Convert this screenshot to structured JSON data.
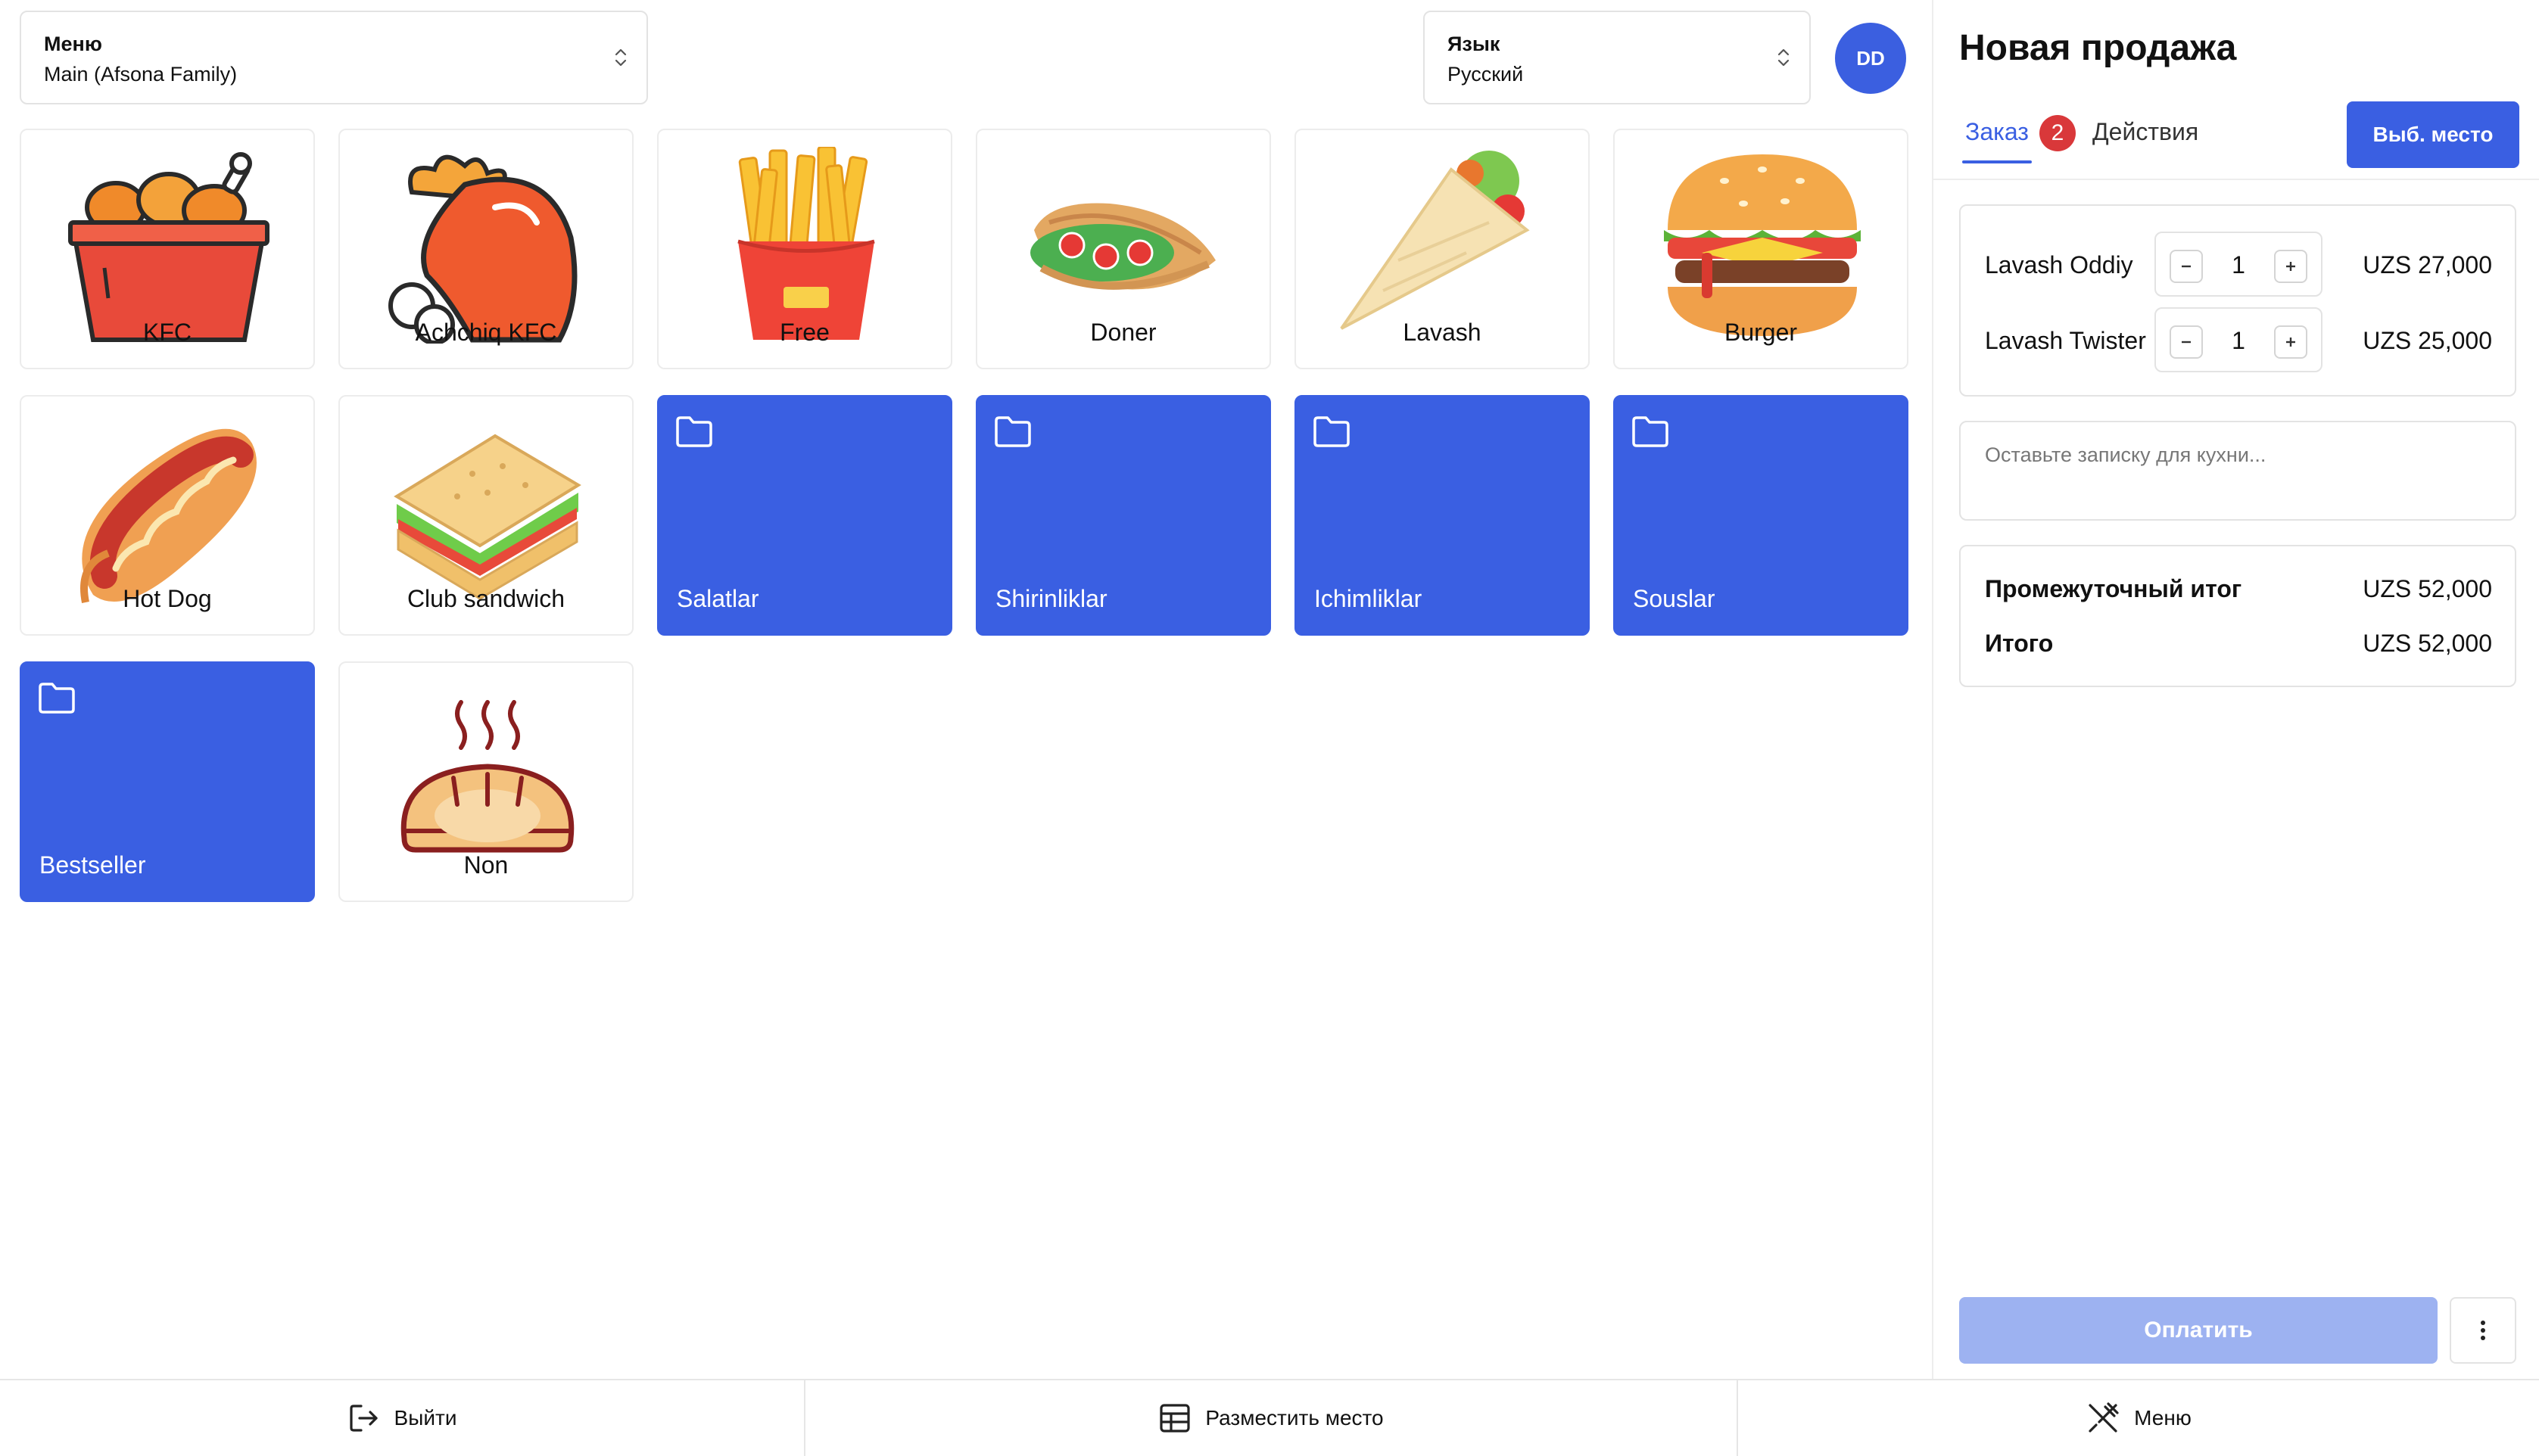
{
  "menu_select": {
    "label": "Меню",
    "value": "Main (Afsona Family)"
  },
  "language_select": {
    "label": "Язык",
    "value": "Русский"
  },
  "user": {
    "initials": "DD"
  },
  "categories": [
    {
      "label": "KFC",
      "icon": "fried-chicken-bucket-icon"
    },
    {
      "label": "Achchiq KFC",
      "icon": "spicy-chicken-leg-icon"
    },
    {
      "label": "Free",
      "icon": "french-fries-icon"
    },
    {
      "label": "Doner",
      "icon": "doner-icon"
    },
    {
      "label": "Lavash",
      "icon": "lavash-wrap-icon"
    },
    {
      "label": "Burger",
      "icon": "burger-icon"
    },
    {
      "label": "Hot Dog",
      "icon": "hot-dog-icon"
    },
    {
      "label": "Club sandwich",
      "icon": "sandwich-icon"
    },
    {
      "label": "Non",
      "icon": "bread-icon"
    }
  ],
  "folders": [
    {
      "label": "Salatlar"
    },
    {
      "label": "Shirinliklar"
    },
    {
      "label": "Ichimliklar"
    },
    {
      "label": "Souslar"
    },
    {
      "label": "Bestseller"
    }
  ],
  "sale": {
    "title": "Новая продажа",
    "tab_order": "Заказ",
    "order_count": "2",
    "tab_actions": "Действия",
    "place_button": "Выб. место",
    "items": [
      {
        "name": "Lavash Oddiy",
        "qty": "1",
        "price": "UZS 27,000"
      },
      {
        "name": "Lavash Twister",
        "qty": "1",
        "price": "UZS 25,000"
      }
    ],
    "note_placeholder": "Оставьте записку для кухни...",
    "subtotal_label": "Промежуточный итог",
    "subtotal_value": "UZS 52,000",
    "total_label": "Итого",
    "total_value": "UZS 52,000",
    "pay_button": "Оплатить"
  },
  "bottom_bar": {
    "logout": "Выйти",
    "place_table": "Разместить место",
    "menu": "Меню"
  },
  "colors": {
    "accent": "#3a5fe2",
    "badge": "#d9383a",
    "pay_disabled": "#9db2f1"
  }
}
